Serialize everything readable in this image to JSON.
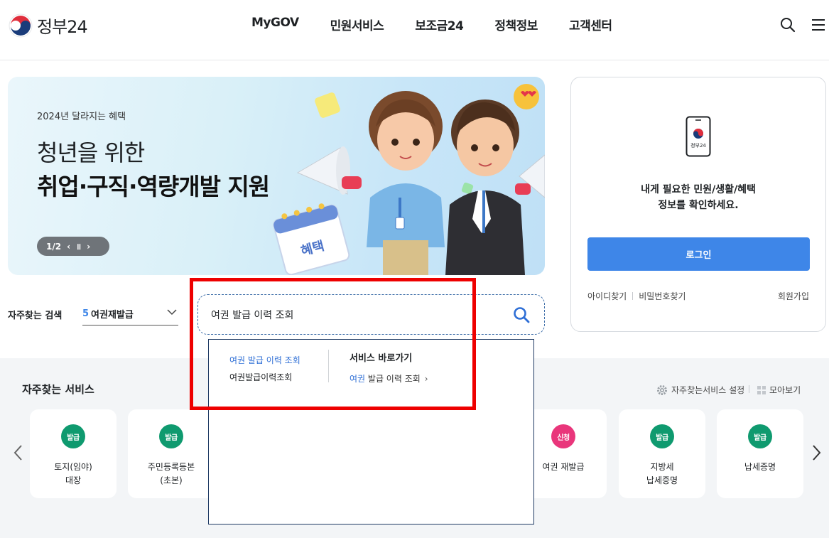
{
  "header": {
    "logo_text": "정부24",
    "nav": [
      "MyGOV",
      "민원서비스",
      "보조금24",
      "정책정보",
      "고객센터"
    ],
    "icons": [
      "search-icon",
      "menu-icon"
    ]
  },
  "banner": {
    "subtitle": "2024년 달라지는 혜택",
    "title_line1": "청년을 위한",
    "title_line2": "취업·구직·역량개발 지원",
    "page_indicator": "1/2",
    "calendar_text": "혜택"
  },
  "login": {
    "message_line1": "내게 필요한 민원/생활/혜택",
    "message_line2": "정보를 확인하세요.",
    "phone_text": "정부24",
    "login_button": "로그인",
    "find_id": "아이디찾기",
    "find_password": "비밀번호찾기",
    "signup": "회원가입"
  },
  "frequent_search": {
    "label": "자주찾는 검색",
    "selected_rank": "5",
    "selected_text": "여권재발급"
  },
  "search": {
    "value": "여권 발급 이력 조회",
    "placeholder": ""
  },
  "autocomplete": {
    "suggestions": [
      "여권 발급 이력 조회",
      "여권발급이력조회"
    ],
    "service_heading": "서비스 바로가기",
    "service_link_highlight": "여권",
    "service_link_rest": " 발급 이력 조회",
    "service_link_arrow": "›"
  },
  "services": {
    "title": "자주찾는 서비스",
    "setting_label": "자주찾는서비스 설정",
    "view_all_label": "모아보기",
    "cards": [
      {
        "badge": "발급",
        "badge_color": "#0f9a6f",
        "line1": "토지(임야)",
        "line2": "대장"
      },
      {
        "badge": "발급",
        "badge_color": "#0f9a6f",
        "line1": "주민등록등본",
        "line2": "(초본)"
      },
      {
        "badge": "신청",
        "badge_color": "#e9367b",
        "line1": "여권 재발급",
        "line2": ""
      },
      {
        "badge": "발급",
        "badge_color": "#0f9a6f",
        "line1": "지방세",
        "line2": "납세증명"
      },
      {
        "badge": "발급",
        "badge_color": "#0f9a6f",
        "line1": "납세증명",
        "line2": ""
      }
    ]
  },
  "colors": {
    "primary_blue": "#3e86e8",
    "highlight_red": "#ee0000",
    "badge_green": "#0f9a6f",
    "badge_pink": "#e9367b"
  }
}
